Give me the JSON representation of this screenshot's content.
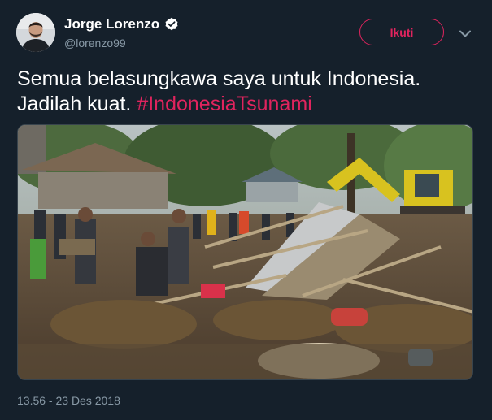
{
  "user": {
    "display_name": "Jorge Lorenzo",
    "handle": "@lorenzo99",
    "verified": true
  },
  "actions": {
    "follow_label": "Ikuti",
    "menu_icon": "chevron-down-icon"
  },
  "tweet": {
    "text_line1": "Semua belasungkawa saya untuk Indonesia.",
    "text_line2_prefix": "Jadilah kuat. ",
    "hashtag": "#IndonesiaTsunami"
  },
  "media": {
    "type": "photo",
    "icon": "photo-icon"
  },
  "meta": {
    "timestamp": "13.56 - 23 Des 2018"
  },
  "colors": {
    "background": "#15202b",
    "accent": "#e0245e",
    "muted": "#8899a6",
    "verified": "#ffffff"
  }
}
